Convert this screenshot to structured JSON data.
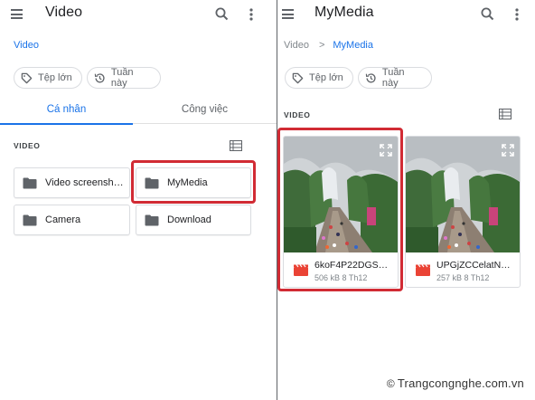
{
  "left": {
    "appbar": {
      "title": "Video",
      "menu_icon": "hamburger-menu-icon",
      "search_icon": "search-icon",
      "more_icon": "more-vert-icon"
    },
    "breadcrumb": "Video",
    "chips": [
      {
        "label": "Tệp lớn",
        "icon": "tag-icon"
      },
      {
        "label": "Tuần này",
        "icon": "history-icon"
      }
    ],
    "tabs": [
      {
        "label": "Cá nhân",
        "selected": true
      },
      {
        "label": "Công việc",
        "selected": false
      }
    ],
    "section_label": "VIDEO",
    "view_icon": "list-view-icon",
    "folders": [
      {
        "name": "Video screenshots",
        "display": "Video screensh…",
        "icon": "folder-icon"
      },
      {
        "name": "MyMedia",
        "display": "MyMedia",
        "icon": "folder-icon",
        "highlighted": true
      },
      {
        "name": "Camera",
        "display": "Camera",
        "icon": "folder-icon"
      },
      {
        "name": "Download",
        "display": "Download",
        "icon": "folder-icon"
      }
    ]
  },
  "right": {
    "appbar": {
      "title": "MyMedia",
      "menu_icon": "hamburger-menu-icon",
      "search_icon": "search-icon",
      "more_icon": "more-vert-icon"
    },
    "breadcrumb": {
      "parent": "Video",
      "separator": ">",
      "current": "MyMedia"
    },
    "chips": [
      {
        "label": "Tệp lớn",
        "icon": "tag-icon"
      },
      {
        "label": "Tuần này",
        "icon": "history-icon"
      }
    ],
    "section_label": "VIDEO",
    "view_icon": "list-view-icon",
    "videos": [
      {
        "name": "6koF4P22DGS…",
        "info": "506 kB 8 Th12",
        "icon": "video-file-icon",
        "highlighted": true
      },
      {
        "name": "UPGjZCCelatN…",
        "info": "257 kB 8 Th12",
        "icon": "video-file-icon"
      }
    ]
  },
  "colors": {
    "accent": "#1a73e8",
    "highlight": "#d12b34",
    "video_icon": "#ea4335",
    "folder": "#5f6368"
  },
  "watermark": {
    "symbol": "©",
    "text": "Trangcongnghe.com.vn"
  }
}
